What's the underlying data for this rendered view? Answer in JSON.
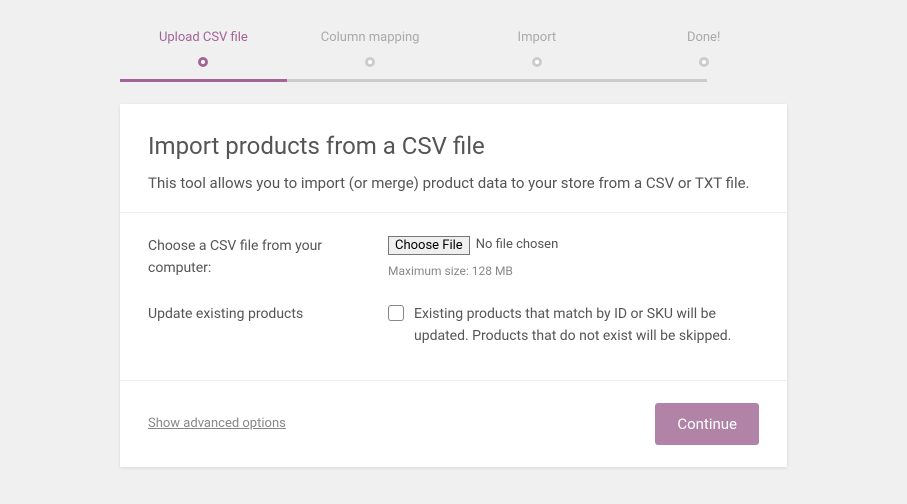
{
  "stepper": {
    "steps": [
      {
        "label": "Upload CSV file",
        "active": true
      },
      {
        "label": "Column mapping",
        "active": false
      },
      {
        "label": "Import",
        "active": false
      },
      {
        "label": "Done!",
        "active": false
      }
    ]
  },
  "header": {
    "title": "Import products from a CSV file",
    "description": "This tool allows you to import (or merge) product data to your store from a CSV or TXT file."
  },
  "fileRow": {
    "label": "Choose a CSV file from your computer:",
    "button": "Choose File",
    "status": "No file chosen",
    "hint": "Maximum size: 128 MB"
  },
  "updateRow": {
    "label": "Update existing products",
    "description": "Existing products that match by ID or SKU will be updated. Products that do not exist will be skipped."
  },
  "footer": {
    "advanced": "Show advanced options",
    "continue": "Continue"
  }
}
